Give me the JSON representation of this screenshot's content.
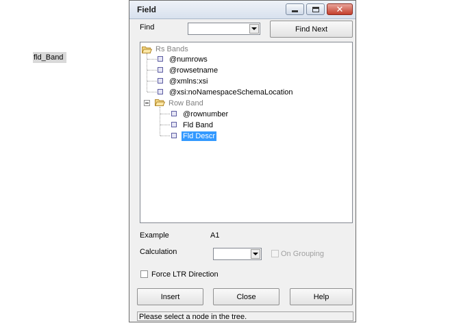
{
  "background": {
    "label": "fld_Band"
  },
  "dialog": {
    "title": "Field",
    "find": {
      "label": "Find",
      "value": "",
      "find_next": "Find Next"
    },
    "tree": {
      "root": "Rs Bands",
      "root_children": [
        "@numrows",
        "@rowsetname",
        "@xmlns:xsi",
        "@xsi:noNamespaceSchemaLocation"
      ],
      "row_band": "Row Band",
      "row_band_children": [
        "@rownumber",
        "Fld Band",
        "Fld Descr"
      ],
      "selected": "Fld Descr"
    },
    "example": {
      "label": "Example",
      "value": "A1"
    },
    "calculation": {
      "label": "Calculation",
      "value": ""
    },
    "on_grouping": {
      "label": "On Grouping",
      "checked": false,
      "enabled": false
    },
    "force_ltr": {
      "label": "Force LTR Direction",
      "checked": false
    },
    "buttons": {
      "insert": "Insert",
      "close": "Close",
      "help": "Help"
    },
    "status": "Please select a node in the tree."
  },
  "colors": {
    "selection": "#3399ff",
    "close_button": "#c43f2d",
    "titlebar": "#d8e1ee"
  }
}
